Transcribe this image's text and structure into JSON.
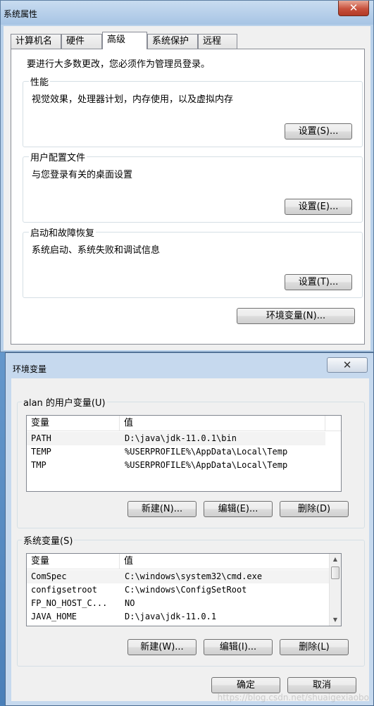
{
  "system_properties": {
    "title": "系统属性",
    "close_glyph": "✕",
    "tabs": [
      "计算机名",
      "硬件",
      "高级",
      "系统保护",
      "远程"
    ],
    "active_tab": "高级",
    "intro": "要进行大多数更改，您必须作为管理员登录。",
    "groups": [
      {
        "legend": "性能",
        "desc": "视觉效果，处理器计划，内存使用，以及虚拟内存",
        "button": "设置(S)..."
      },
      {
        "legend": "用户配置文件",
        "desc": "与您登录有关的桌面设置",
        "button": "设置(E)..."
      },
      {
        "legend": "启动和故障恢复",
        "desc": "系统启动、系统失败和调试信息",
        "button": "设置(T)..."
      }
    ],
    "env_button": "环境变量(N)..."
  },
  "env_dialog": {
    "title": "环境变量",
    "close_glyph": "✕",
    "user_section": {
      "legend": "alan 的用户变量(U)",
      "headers": [
        "变量",
        "值"
      ],
      "rows": [
        {
          "name": "PATH",
          "value": "D:\\java\\jdk-11.0.1\\bin"
        },
        {
          "name": "TEMP",
          "value": "%USERPROFILE%\\AppData\\Local\\Temp"
        },
        {
          "name": "TMP",
          "value": "%USERPROFILE%\\AppData\\Local\\Temp"
        }
      ],
      "buttons": [
        "新建(N)...",
        "编辑(E)...",
        "删除(D)"
      ]
    },
    "system_section": {
      "legend": "系统变量(S)",
      "headers": [
        "变量",
        "值"
      ],
      "rows": [
        {
          "name": "ComSpec",
          "value": "C:\\windows\\system32\\cmd.exe"
        },
        {
          "name": "configsetroot",
          "value": "C:\\windows\\ConfigSetRoot"
        },
        {
          "name": "FP_NO_HOST_C...",
          "value": "NO"
        },
        {
          "name": "JAVA_HOME",
          "value": "D:\\java\\jdk-11.0.1"
        }
      ],
      "buttons": [
        "新建(W)...",
        "编辑(I)...",
        "删除(L)"
      ]
    },
    "ok_button": "确定",
    "cancel_button": "取消",
    "watermark": "https://blog.csdn.net/shuaigexiaobo"
  }
}
